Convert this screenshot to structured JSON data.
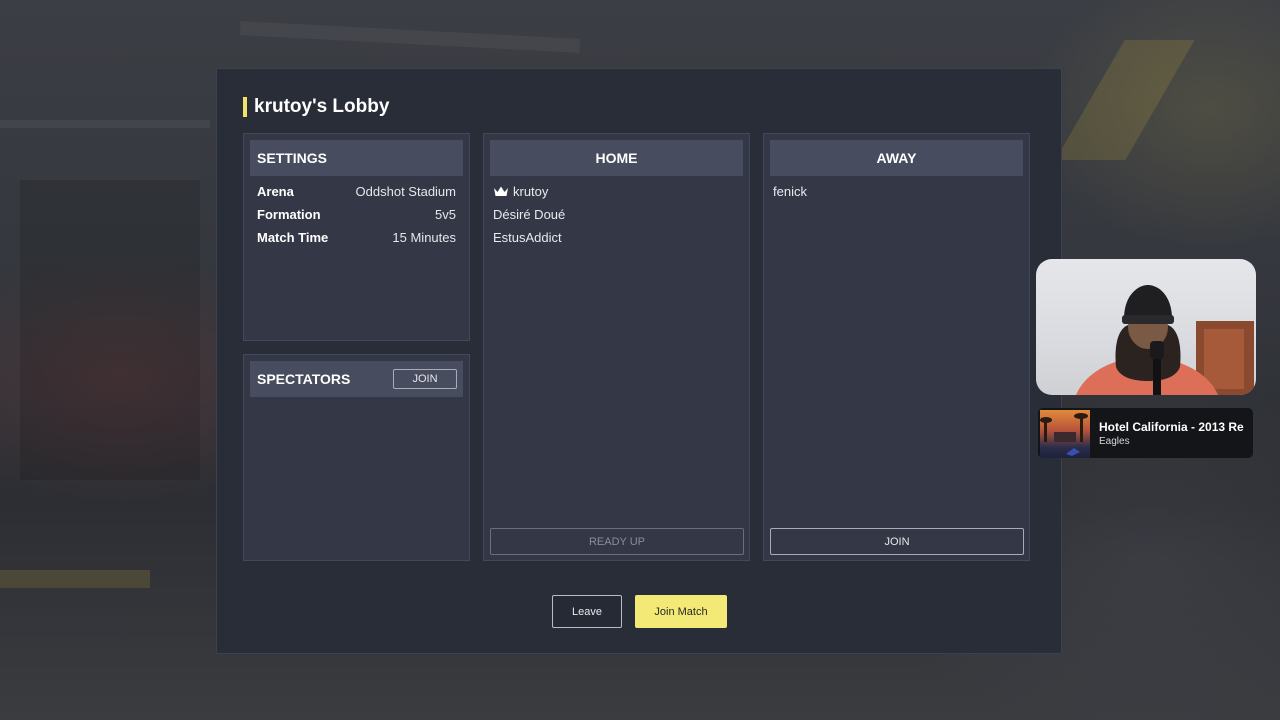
{
  "lobby": {
    "title": "krutoy's Lobby"
  },
  "settings": {
    "header": "SETTINGS",
    "rows": [
      {
        "label": "Arena",
        "value": "Oddshot Stadium"
      },
      {
        "label": "Formation",
        "value": "5v5"
      },
      {
        "label": "Match Time",
        "value": "15 Minutes"
      }
    ]
  },
  "spectators": {
    "header": "SPECTATORS",
    "join_label": "JOIN"
  },
  "home": {
    "header": "HOME",
    "players": [
      "krutoy",
      "Désiré Doué",
      "EstusAddict"
    ],
    "host_icon": "crown-icon",
    "ready_label": "READY UP"
  },
  "away": {
    "header": "AWAY",
    "players": [
      "fenick"
    ],
    "join_label": "JOIN"
  },
  "actions": {
    "leave_label": "Leave",
    "join_match_label": "Join Match"
  },
  "now_playing": {
    "title": "Hotel California - 2013 Re",
    "artist": "Eagles"
  },
  "colors": {
    "accent": "#f2e977",
    "panel": "#292d38",
    "card": "#343846",
    "header": "#474c5e"
  }
}
